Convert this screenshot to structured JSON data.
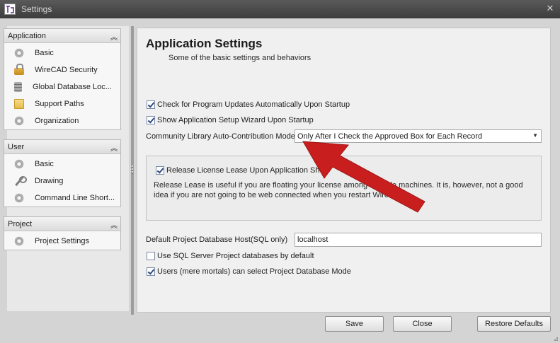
{
  "window": {
    "title": "Settings",
    "close_glyph": "✕",
    "app_icon": "wirecad-app-icon"
  },
  "nav": {
    "groups": [
      {
        "header": "Application",
        "items": [
          {
            "label": "Basic",
            "icon": "gear-icon"
          },
          {
            "label": "WireCAD Security",
            "icon": "lock-icon"
          },
          {
            "label": "Global Database Loc...",
            "icon": "database-icon"
          },
          {
            "label": "Support Paths",
            "icon": "folder-icon"
          },
          {
            "label": "Organization",
            "icon": "gear-icon"
          }
        ]
      },
      {
        "header": "User",
        "items": [
          {
            "label": "Basic",
            "icon": "gear-icon"
          },
          {
            "label": "Drawing",
            "icon": "wrench-icon"
          },
          {
            "label": "Command Line Short...",
            "icon": "gear-icon"
          }
        ]
      },
      {
        "header": "Project",
        "items": [
          {
            "label": "Project Settings",
            "icon": "gear-icon"
          }
        ]
      }
    ],
    "collapse_glyph": "︽"
  },
  "main": {
    "title": "Application Settings",
    "subtitle": "Some of the basic settings and behaviors",
    "check_updates": {
      "label": "Check for Program Updates Automatically Upon Startup",
      "checked": true
    },
    "show_wizard": {
      "label": "Show Application Setup Wizard Upon Startup",
      "checked": true
    },
    "contribution_label": "Community Library Auto-Contribution Mode",
    "contribution_value": "Only After I Check the Approved Box for Each Record",
    "release_lease": {
      "label": "Release License Lease Upon Application Sh",
      "checked": true
    },
    "release_desc_line1": "Release Lease is useful if you are floating your license among multiple machines. It is, however, not a good",
    "release_desc_line2": "idea if you are not going to be web connected when you restart WireCAD.",
    "db_host_label": "Default Project Database Host(SQL only)",
    "db_host_value": "localhost",
    "use_sql": {
      "label": "Use SQL Server Project databases by default",
      "checked": false
    },
    "users_select": {
      "label": "Users (mere mortals) can select Project Database Mode",
      "checked": true
    }
  },
  "buttons": {
    "save": "Save",
    "close": "Close",
    "restore": "Restore Defaults"
  },
  "colors": {
    "annotation_arrow": "#c81e1e",
    "titlebar": "#4a4a4a"
  }
}
